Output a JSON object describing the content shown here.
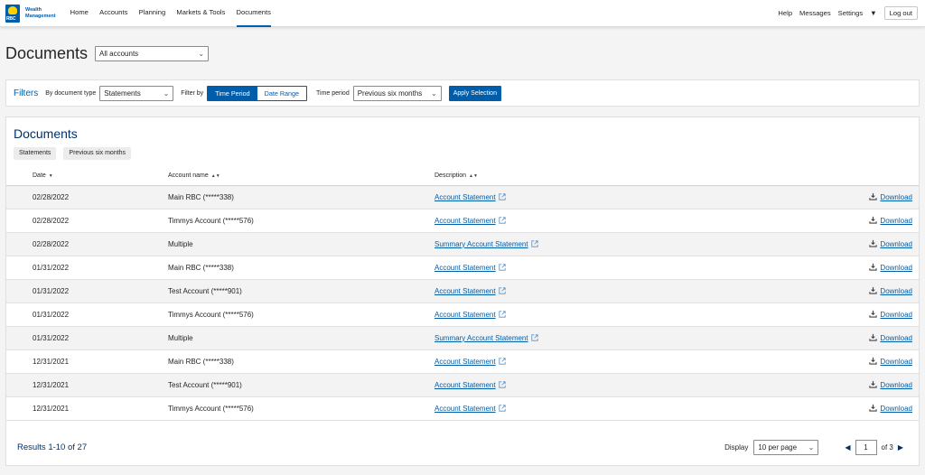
{
  "header": {
    "logo_text_line1": "Wealth",
    "logo_text_line2": "Management",
    "logo_badge_text": "RBC",
    "nav": [
      "Home",
      "Accounts",
      "Planning",
      "Markets & Tools",
      "Documents"
    ],
    "active_nav": "Documents",
    "help": "Help",
    "messages": "Messages",
    "settings": "Settings",
    "logout": "Log out"
  },
  "page": {
    "title": "Documents",
    "account_select": "All accounts"
  },
  "filters": {
    "title": "Filters",
    "doc_type_label": "By document type",
    "doc_type_value": "Statements",
    "filter_by_label": "Filter by",
    "seg_time_period": "Time Period",
    "seg_date_range": "Date Range",
    "time_period_label": "Time period",
    "time_period_value": "Previous six months",
    "apply_label": "Apply Selection"
  },
  "documents": {
    "title": "Documents",
    "chips": [
      "Statements",
      "Previous six months"
    ],
    "columns": {
      "date": "Date",
      "account": "Account name",
      "description": "Description"
    },
    "download_label": "Download",
    "rows": [
      {
        "date": "02/28/2022",
        "account": "Main RBC (*****338)",
        "description": "Account Statement"
      },
      {
        "date": "02/28/2022",
        "account": "Timmys Account (*****576)",
        "description": "Account Statement"
      },
      {
        "date": "02/28/2022",
        "account": "Multiple",
        "description": "Summary Account Statement"
      },
      {
        "date": "01/31/2022",
        "account": "Main RBC (*****338)",
        "description": "Account Statement"
      },
      {
        "date": "01/31/2022",
        "account": "Test Account (*****901)",
        "description": "Account Statement"
      },
      {
        "date": "01/31/2022",
        "account": "Timmys Account (*****576)",
        "description": "Account Statement"
      },
      {
        "date": "01/31/2022",
        "account": "Multiple",
        "description": "Summary Account Statement"
      },
      {
        "date": "12/31/2021",
        "account": "Main RBC (*****338)",
        "description": "Account Statement"
      },
      {
        "date": "12/31/2021",
        "account": "Test Account (*****901)",
        "description": "Account Statement"
      },
      {
        "date": "12/31/2021",
        "account": "Timmys Account (*****576)",
        "description": "Account Statement"
      }
    ]
  },
  "footer": {
    "results": "Results 1-10 of 27",
    "display_label": "Display",
    "per_page": "10 per page",
    "page_value": "1",
    "of_pages": "of 3"
  },
  "colors": {
    "brand_blue": "#005daa",
    "dark_blue": "#003168",
    "logo_yellow": "#ffd200"
  },
  "icons": [
    "external-link-icon",
    "download-icon",
    "chevron-down-icon",
    "prev-page-icon",
    "next-page-icon"
  ]
}
